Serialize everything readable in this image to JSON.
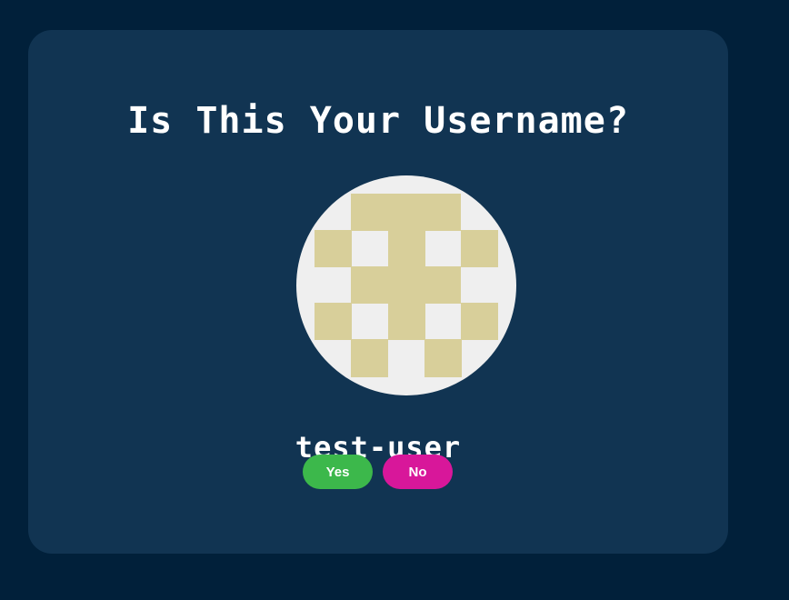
{
  "title": "Is This Your Username?",
  "avatar": {
    "icon": "identicon",
    "foreground_color": "#d8cf9a",
    "background_color": "#efefef"
  },
  "username": "test-user",
  "buttons": {
    "yes": {
      "label": "Yes",
      "color": "#3cb84b"
    },
    "no": {
      "label": "No",
      "color": "#d8179a"
    }
  },
  "colors": {
    "page_background": "#01203a",
    "card_background": "#113452",
    "text": "#ffffff"
  }
}
